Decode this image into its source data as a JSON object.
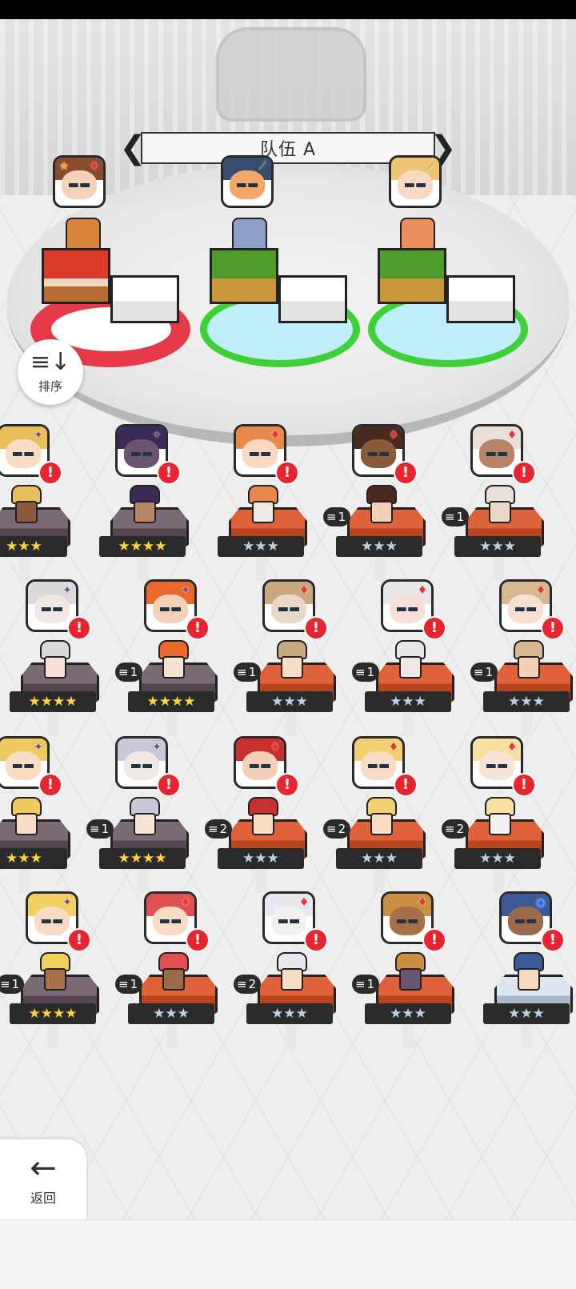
{
  "team": {
    "name": "队伍 A",
    "prev_arrow": "❮",
    "next_arrow": "❯"
  },
  "sort_button": {
    "icon": "≡↓",
    "label": "排序"
  },
  "back_button": {
    "icon": "←",
    "label": "返回"
  },
  "slots": [
    {
      "pad_color": "#e63a4a",
      "element": "fire",
      "leader": true
    },
    {
      "pad_color": "#3fcf37",
      "element": "earth",
      "leader": false
    },
    {
      "pad_color": "#3fcf37",
      "element": "earth",
      "leader": false
    }
  ],
  "symbols": {
    "fire": "♦",
    "dark": "✦",
    "earth": "⟋",
    "water": "◉",
    "leader": "★",
    "alert": "!",
    "level_icon": "≡"
  },
  "heroes": [
    {
      "row": 0,
      "col": 0,
      "element": "dark",
      "stars": "★★★",
      "star_type": "gold",
      "level": "",
      "ped": "purple"
    },
    {
      "row": 0,
      "col": 1,
      "element": "dark",
      "stars": "★★★★",
      "star_type": "gold",
      "level": "",
      "ped": "purple"
    },
    {
      "row": 0,
      "col": 2,
      "element": "fire",
      "stars": "★★★",
      "star_type": "silver",
      "level": "",
      "ped": "orange"
    },
    {
      "row": 0,
      "col": 3,
      "element": "fire",
      "stars": "★★★",
      "star_type": "silver",
      "level": "1",
      "ped": "orange"
    },
    {
      "row": 0,
      "col": 4,
      "element": "fire",
      "stars": "★★★",
      "star_type": "silver",
      "level": "1",
      "ped": "orange"
    },
    {
      "row": 1,
      "col": 0,
      "element": "dark",
      "stars": "★★★★",
      "star_type": "gold",
      "level": "",
      "ped": "purple"
    },
    {
      "row": 1,
      "col": 1,
      "element": "dark",
      "stars": "★★★★",
      "star_type": "gold",
      "level": "1",
      "ped": "purple"
    },
    {
      "row": 1,
      "col": 2,
      "element": "fire",
      "stars": "★★★",
      "star_type": "silver",
      "level": "1",
      "ped": "orange"
    },
    {
      "row": 1,
      "col": 3,
      "element": "fire",
      "stars": "★★★",
      "star_type": "silver",
      "level": "1",
      "ped": "orange"
    },
    {
      "row": 1,
      "col": 4,
      "element": "fire",
      "stars": "★★★",
      "star_type": "silver",
      "level": "1",
      "ped": "orange"
    },
    {
      "row": 2,
      "col": 0,
      "element": "dark",
      "stars": "★★★",
      "star_type": "gold",
      "level": "",
      "ped": "purple"
    },
    {
      "row": 2,
      "col": 1,
      "element": "dark",
      "stars": "★★★★",
      "star_type": "gold",
      "level": "1",
      "ped": "purple"
    },
    {
      "row": 2,
      "col": 2,
      "element": "fire",
      "stars": "★★★",
      "star_type": "silver",
      "level": "2",
      "ped": "orange"
    },
    {
      "row": 2,
      "col": 3,
      "element": "fire",
      "stars": "★★★",
      "star_type": "silver",
      "level": "2",
      "ped": "orange"
    },
    {
      "row": 2,
      "col": 4,
      "element": "fire",
      "stars": "★★★",
      "star_type": "silver",
      "level": "2",
      "ped": "orange"
    },
    {
      "row": 3,
      "col": 0,
      "element": "dark",
      "stars": "★★★★",
      "star_type": "gold",
      "level": "1",
      "ped": "purple"
    },
    {
      "row": 3,
      "col": 1,
      "element": "fire",
      "stars": "★★★",
      "star_type": "silver",
      "level": "1",
      "ped": "orange"
    },
    {
      "row": 3,
      "col": 2,
      "element": "fire",
      "stars": "★★★",
      "star_type": "silver",
      "level": "2",
      "ped": "orange"
    },
    {
      "row": 3,
      "col": 3,
      "element": "fire",
      "stars": "★★★",
      "star_type": "silver",
      "level": "1",
      "ped": "orange"
    },
    {
      "row": 3,
      "col": 4,
      "element": "water",
      "stars": "★★★",
      "star_type": "silver",
      "level": "",
      "ped": "ice"
    }
  ]
}
